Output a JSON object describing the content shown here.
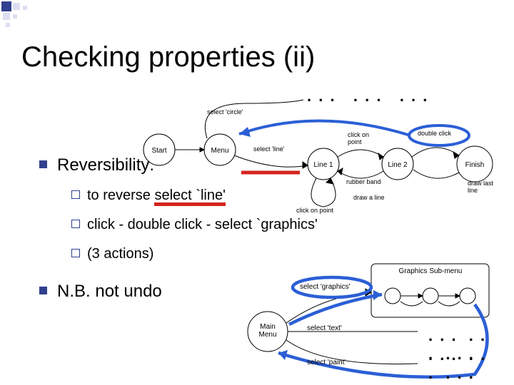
{
  "title": "Checking properties (ii)",
  "bullets": {
    "reversibility": "Reversibility:",
    "nb": "N.B. not undo"
  },
  "sub": {
    "to_reverse_pre": "to reverse ",
    "to_reverse_underlined": "select `line'",
    "click_line": "click - double click - select `graphics'",
    "actions": "(3 actions)"
  },
  "top_diagram": {
    "start": "Start",
    "menu": "Menu",
    "line1": "Line 1",
    "line2": "Line 2",
    "finish": "Finish",
    "sel_circle": "select 'circle'",
    "sel_line": "select 'line'",
    "click_point_top": "click on\npoint",
    "double_click": "double click",
    "rubber_band": "rubber band",
    "click_point_bot": "click on point",
    "draw_line": "draw a line",
    "draw_last": "draw last\nline",
    "dots": ". . ."
  },
  "bottom_diagram": {
    "main_menu": "Main\nMenu",
    "sub_menu": "Graphics Sub-menu",
    "sel_graphics": "select 'graphics'",
    "sel_text": "select 'text'",
    "sel_paint": "select 'paint'",
    "dots": ". . ."
  }
}
